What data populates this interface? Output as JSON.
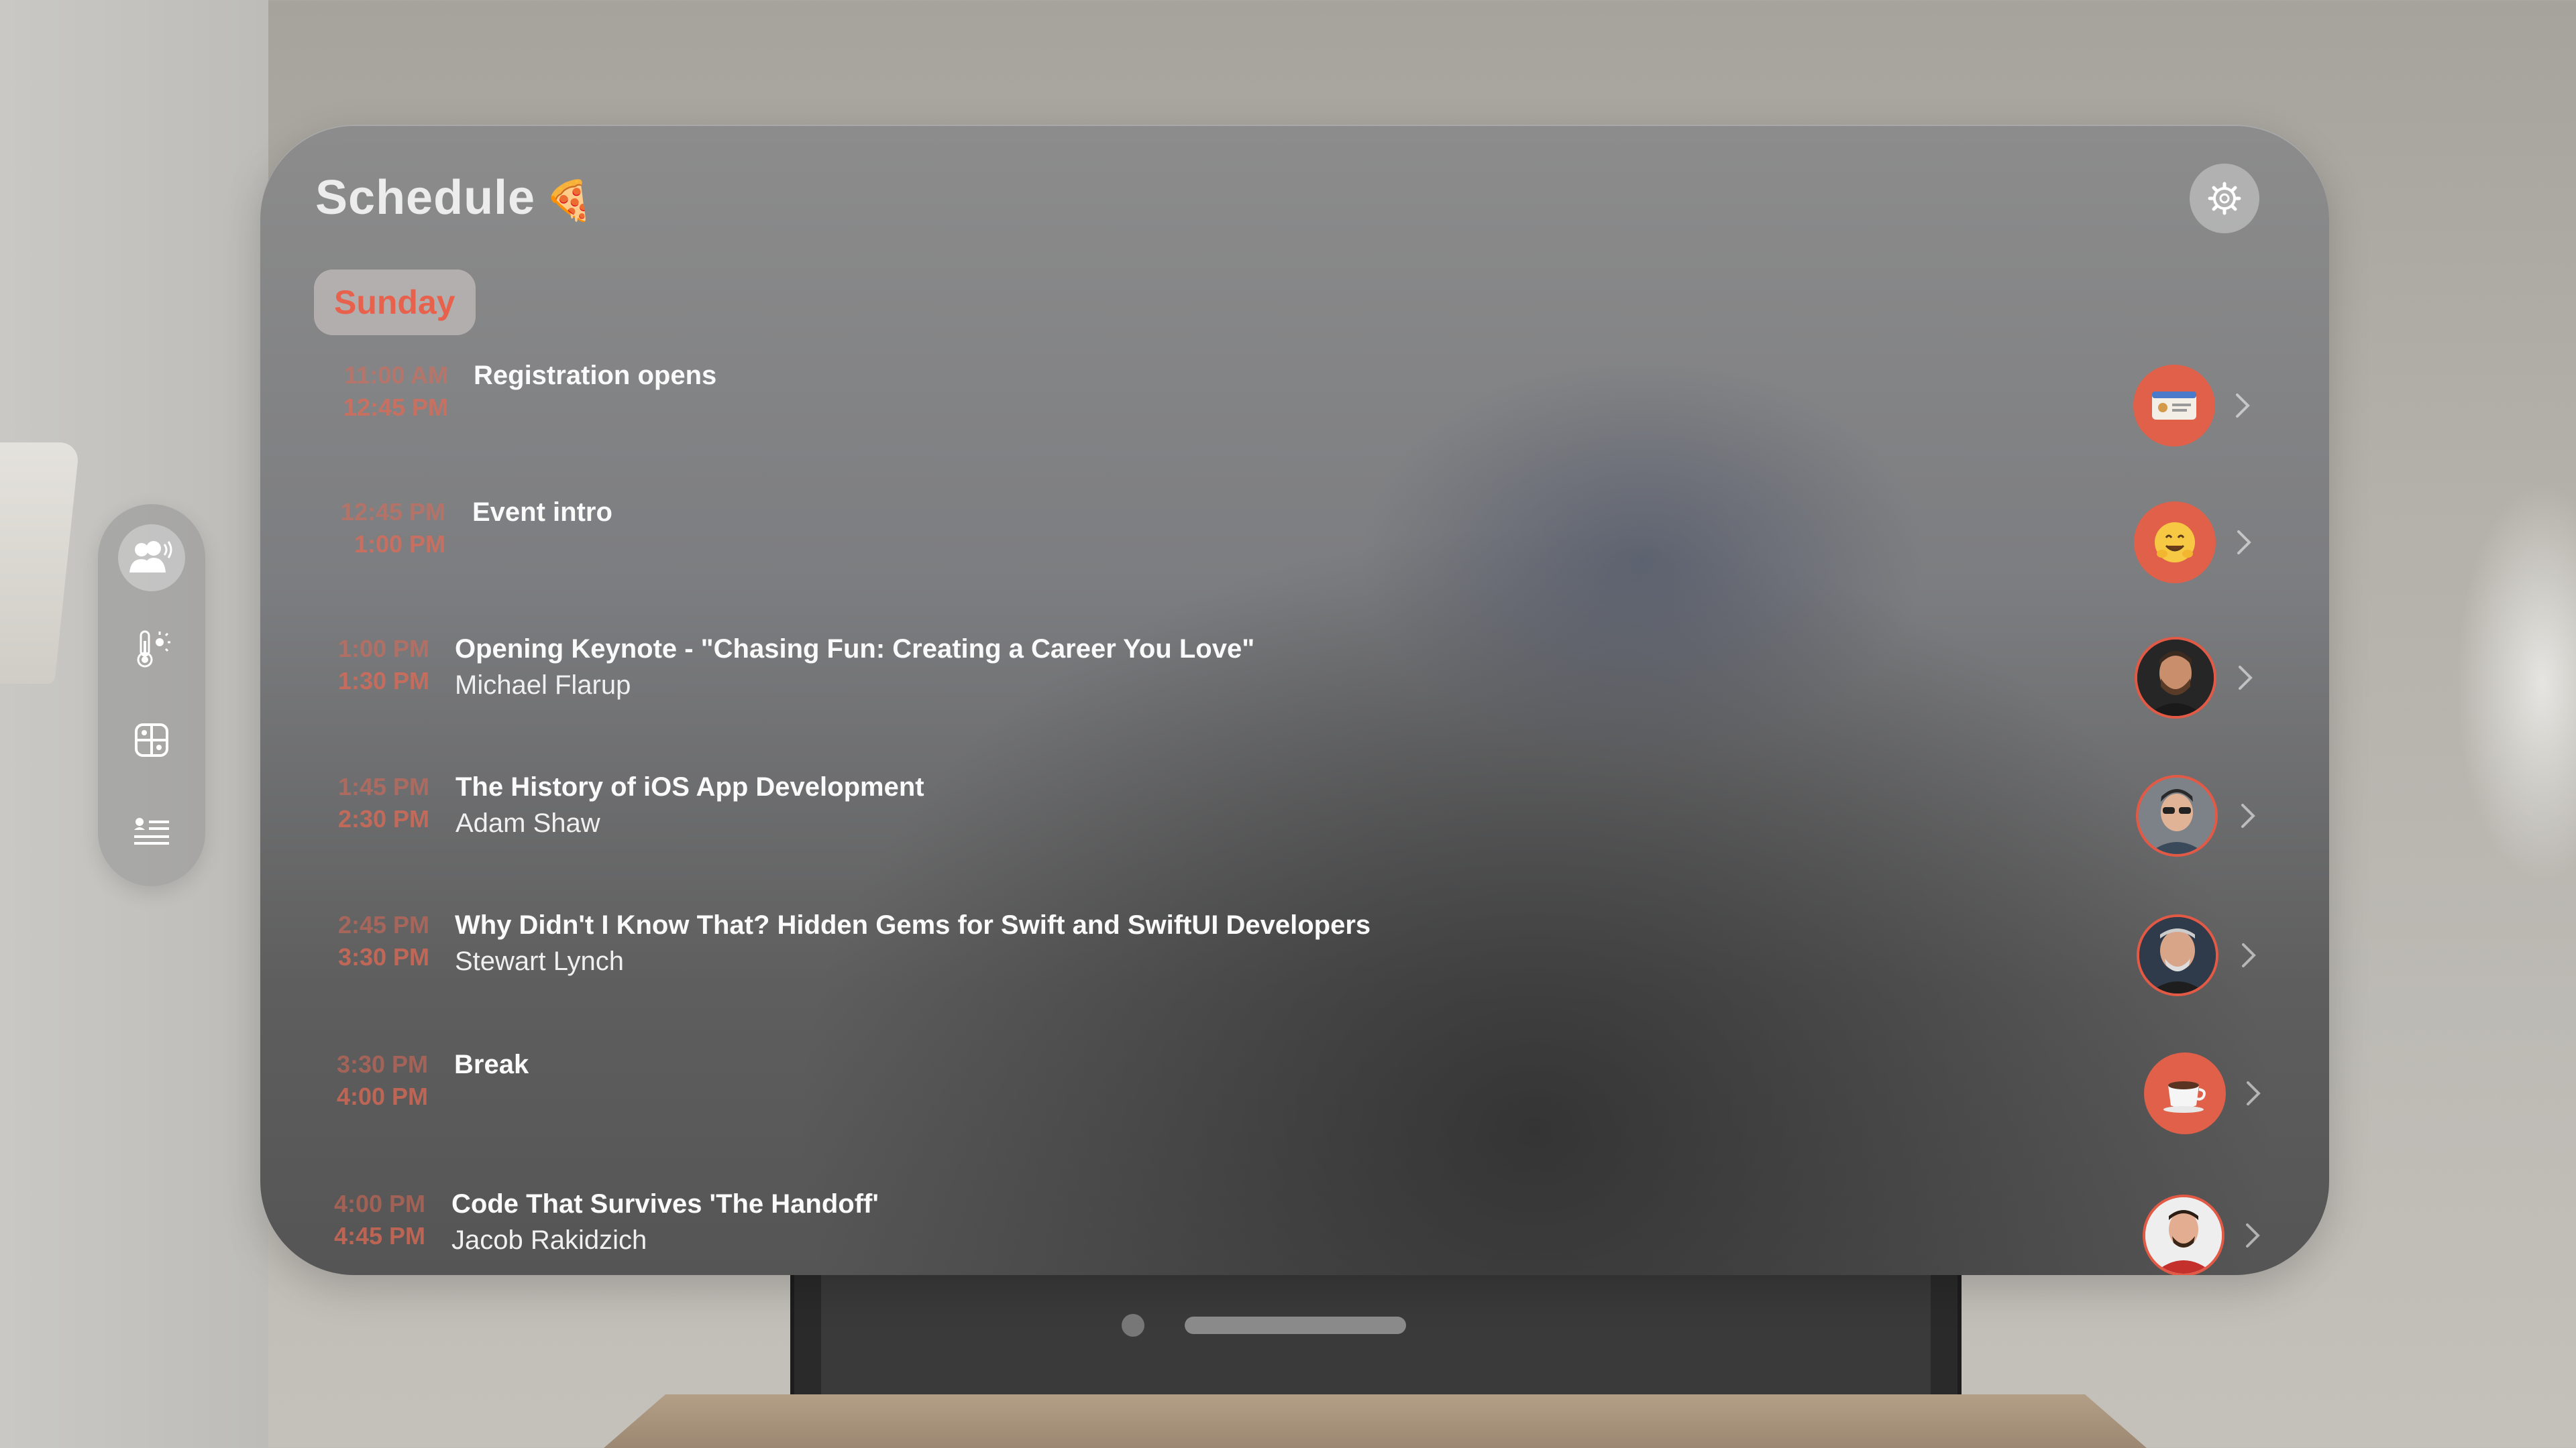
{
  "header": {
    "title": "Schedule",
    "title_emoji": "🍕"
  },
  "day_tab": {
    "label": "Sunday"
  },
  "sessions": [
    {
      "start": "11:00 AM",
      "end": "12:45 PM",
      "title": "Registration opens",
      "speaker": "",
      "icon": "id-card-icon"
    },
    {
      "start": "12:45 PM",
      "end": "1:00 PM",
      "title": "Event intro",
      "speaker": "",
      "icon": "hugging-face-emoji-icon"
    },
    {
      "start": "1:00 PM",
      "end": "1:30 PM",
      "title": "Opening Keynote - \"Chasing Fun: Creating a Career You Love\"",
      "speaker": "Michael Flarup",
      "icon": "speaker-photo"
    },
    {
      "start": "1:45 PM",
      "end": "2:30 PM",
      "title": "The History of iOS App Development",
      "speaker": "Adam Shaw",
      "icon": "speaker-photo"
    },
    {
      "start": "2:45 PM",
      "end": "3:30 PM",
      "title": "Why Didn't I Know That? Hidden Gems for Swift and SwiftUI Developers",
      "speaker": "Stewart Lynch",
      "icon": "speaker-photo"
    },
    {
      "start": "3:30 PM",
      "end": "4:00 PM",
      "title": "Break",
      "speaker": "",
      "icon": "coffee-icon"
    },
    {
      "start": "4:00 PM",
      "end": "4:45 PM",
      "title": "Code That Survives 'The Handoff'",
      "speaker": "Jacob Rakidzich",
      "icon": "speaker-photo"
    }
  ],
  "sidebar": {
    "items": [
      {
        "icon": "people-speaking-icon",
        "active": true
      },
      {
        "icon": "thermometer-sun-icon",
        "active": false
      },
      {
        "icon": "app-grid-icon",
        "active": false
      },
      {
        "icon": "list-person-icon",
        "active": false
      }
    ]
  },
  "colors": {
    "accent": "#e8614c",
    "time_text": "#e06a55",
    "title_text": "#fafafa"
  }
}
